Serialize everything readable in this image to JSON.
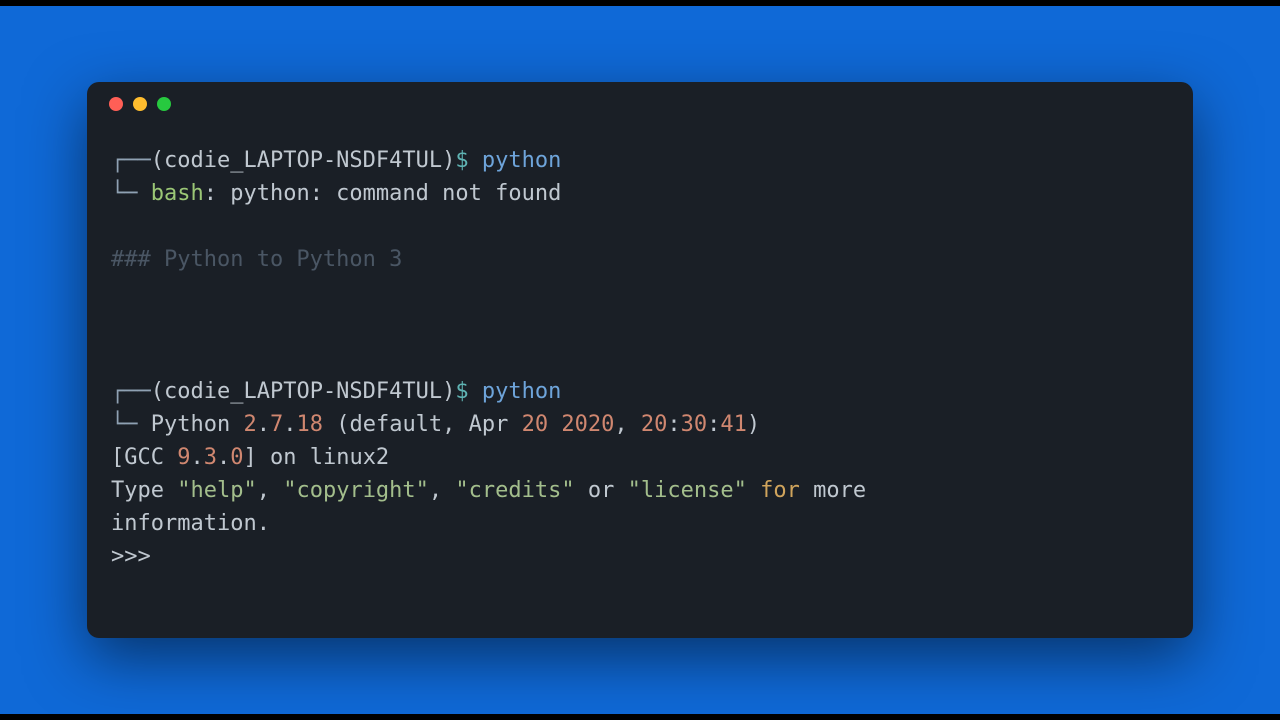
{
  "titlebar": {
    "close": "close",
    "minimize": "minimize",
    "maximize": "maximize"
  },
  "block1": {
    "prefix1": "┌──",
    "host_open": "(",
    "host": "codie_LAPTOP-NSDF4TUL",
    "host_close": ")",
    "dollar": "$ ",
    "command": "python",
    "prefix2": "└─ ",
    "bash_label": "bash",
    "bash_rest": ": python: command not found"
  },
  "comment": "### Python to Python 3",
  "block2": {
    "prefix1": "┌──",
    "host_open": "(",
    "host": "codie_LAPTOP-NSDF4TUL",
    "host_close": ")",
    "dollar": "$ ",
    "command": "python",
    "prefix2": "└─ ",
    "ver_a": "Python ",
    "ver_major": "2",
    "ver_dot1": ".",
    "ver_minor": "7",
    "ver_dot2": ".",
    "ver_patch": "18",
    "ver_b": " (default, Apr ",
    "ver_day": "20",
    "ver_sp": " ",
    "ver_year": "2020",
    "ver_comma": ", ",
    "ver_h": "20",
    "ver_colon1": ":",
    "ver_m": "30",
    "ver_colon2": ":",
    "ver_s": "41",
    "ver_close": ")",
    "gcc_a": "[GCC ",
    "gcc_major": "9",
    "gcc_dot1": ".",
    "gcc_minor": "3",
    "gcc_dot2": ".",
    "gcc_patch": "0",
    "gcc_b": "] on linux2",
    "type_a": "Type ",
    "str_help": "\"help\"",
    "type_b": ", ",
    "str_copyright": "\"copyright\"",
    "type_c": ", ",
    "str_credits": "\"credits\"",
    "type_d": " or ",
    "str_license": "\"license\"",
    "type_sp": " ",
    "kw_for": "for",
    "type_e": " more",
    "info_line": "information.",
    "repl_prompt": ">>> "
  }
}
